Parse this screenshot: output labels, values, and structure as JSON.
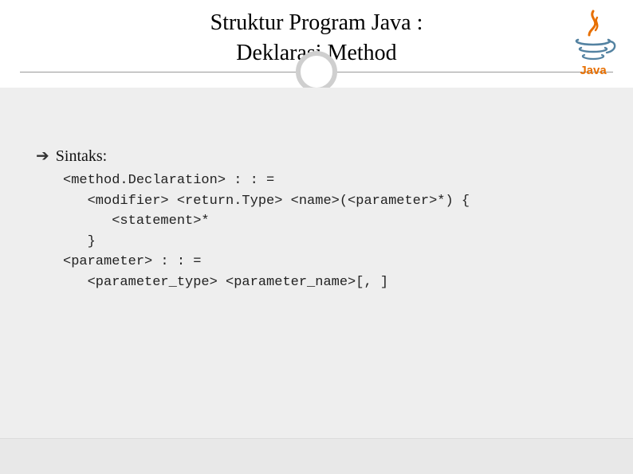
{
  "title_line1": "Struktur Program Java :",
  "title_line2": "Deklarasi Method",
  "logo_label": "Java",
  "bullet_label": "Sintaks:",
  "code": "<method.Declaration> : : =\n   <modifier> <return.Type> <name>(<parameter>*) {\n      <statement>*\n   }\n<parameter> : : =\n   <parameter_type> <parameter_name>[, ]"
}
